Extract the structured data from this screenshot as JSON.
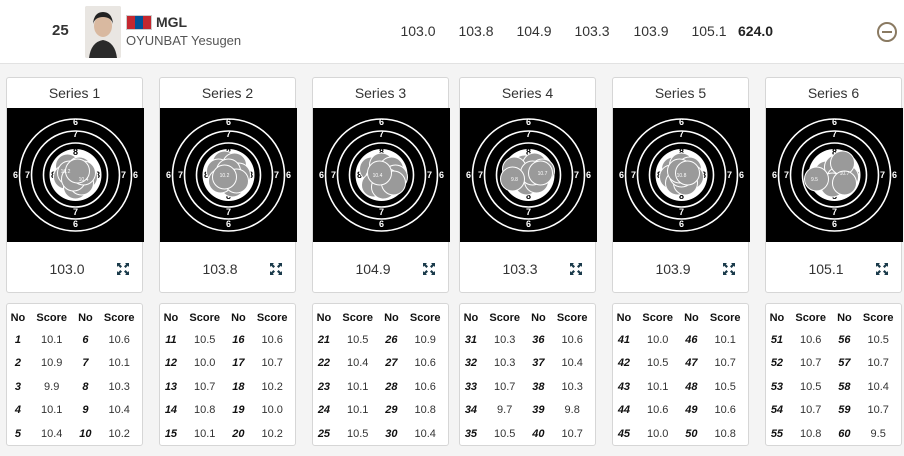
{
  "athlete": {
    "rank": "25",
    "noc": "MGL",
    "name": "OYUNBAT Yesugen",
    "flag_colors": [
      "#c4272f",
      "#015197",
      "#c4272f"
    ],
    "series_scores": [
      "103.0",
      "103.8",
      "104.9",
      "103.3",
      "103.9",
      "105.1"
    ],
    "total": "624.0",
    "collapse_icon": "minus-circle-icon"
  },
  "target_labels": {
    "ring6": "6",
    "ring7": "7",
    "ring8": "8"
  },
  "series": [
    {
      "title": "Series 1",
      "score": "103.0",
      "shots": [
        {
          "no": "1",
          "score": "10.1"
        },
        {
          "no": "2",
          "score": "10.9"
        },
        {
          "no": "3",
          "score": "9.9"
        },
        {
          "no": "4",
          "score": "10.1"
        },
        {
          "no": "5",
          "score": "10.4"
        },
        {
          "no": "6",
          "score": "10.6"
        },
        {
          "no": "7",
          "score": "10.1"
        },
        {
          "no": "8",
          "score": "10.3"
        },
        {
          "no": "9",
          "score": "10.4"
        },
        {
          "no": "10",
          "score": "10.2"
        }
      ],
      "hole_labels": [
        "10.2",
        "10.4"
      ]
    },
    {
      "title": "Series 2",
      "score": "103.8",
      "shots": [
        {
          "no": "11",
          "score": "10.5"
        },
        {
          "no": "12",
          "score": "10.0"
        },
        {
          "no": "13",
          "score": "10.7"
        },
        {
          "no": "14",
          "score": "10.8"
        },
        {
          "no": "15",
          "score": "10.1"
        },
        {
          "no": "16",
          "score": "10.6"
        },
        {
          "no": "17",
          "score": "10.7"
        },
        {
          "no": "18",
          "score": "10.2"
        },
        {
          "no": "19",
          "score": "10.0"
        },
        {
          "no": "20",
          "score": "10.2"
        }
      ],
      "hole_labels": [
        "10.2"
      ]
    },
    {
      "title": "Series 3",
      "score": "104.9",
      "shots": [
        {
          "no": "21",
          "score": "10.5"
        },
        {
          "no": "22",
          "score": "10.4"
        },
        {
          "no": "23",
          "score": "10.1"
        },
        {
          "no": "24",
          "score": "10.1"
        },
        {
          "no": "25",
          "score": "10.5"
        },
        {
          "no": "26",
          "score": "10.9"
        },
        {
          "no": "27",
          "score": "10.6"
        },
        {
          "no": "28",
          "score": "10.6"
        },
        {
          "no": "29",
          "score": "10.8"
        },
        {
          "no": "30",
          "score": "10.4"
        }
      ],
      "hole_labels": [
        "10.4"
      ]
    },
    {
      "title": "Series 4",
      "score": "103.3",
      "shots": [
        {
          "no": "31",
          "score": "10.3"
        },
        {
          "no": "32",
          "score": "10.3"
        },
        {
          "no": "33",
          "score": "10.7"
        },
        {
          "no": "34",
          "score": "9.7"
        },
        {
          "no": "35",
          "score": "10.5"
        },
        {
          "no": "36",
          "score": "10.6"
        },
        {
          "no": "37",
          "score": "10.4"
        },
        {
          "no": "38",
          "score": "10.3"
        },
        {
          "no": "39",
          "score": "9.8"
        },
        {
          "no": "40",
          "score": "10.7"
        }
      ],
      "hole_labels": [
        "9.8",
        "10.7"
      ]
    },
    {
      "title": "Series 5",
      "score": "103.9",
      "shots": [
        {
          "no": "41",
          "score": "10.0"
        },
        {
          "no": "42",
          "score": "10.5"
        },
        {
          "no": "43",
          "score": "10.1"
        },
        {
          "no": "44",
          "score": "10.6"
        },
        {
          "no": "45",
          "score": "10.0"
        },
        {
          "no": "46",
          "score": "10.1"
        },
        {
          "no": "47",
          "score": "10.7"
        },
        {
          "no": "48",
          "score": "10.5"
        },
        {
          "no": "49",
          "score": "10.6"
        },
        {
          "no": "50",
          "score": "10.8"
        }
      ],
      "hole_labels": [
        "10.8"
      ]
    },
    {
      "title": "Series 6",
      "score": "105.1",
      "shots": [
        {
          "no": "51",
          "score": "10.6"
        },
        {
          "no": "52",
          "score": "10.7"
        },
        {
          "no": "53",
          "score": "10.5"
        },
        {
          "no": "54",
          "score": "10.7"
        },
        {
          "no": "55",
          "score": "10.8"
        },
        {
          "no": "56",
          "score": "10.5"
        },
        {
          "no": "57",
          "score": "10.7"
        },
        {
          "no": "58",
          "score": "10.4"
        },
        {
          "no": "59",
          "score": "10.7"
        },
        {
          "no": "60",
          "score": "9.5"
        }
      ],
      "hole_labels": [
        "9.5",
        "10.7"
      ]
    }
  ],
  "table_headers": {
    "no": "No",
    "score": "Score"
  },
  "expand_icon": "expand-arrows-icon"
}
